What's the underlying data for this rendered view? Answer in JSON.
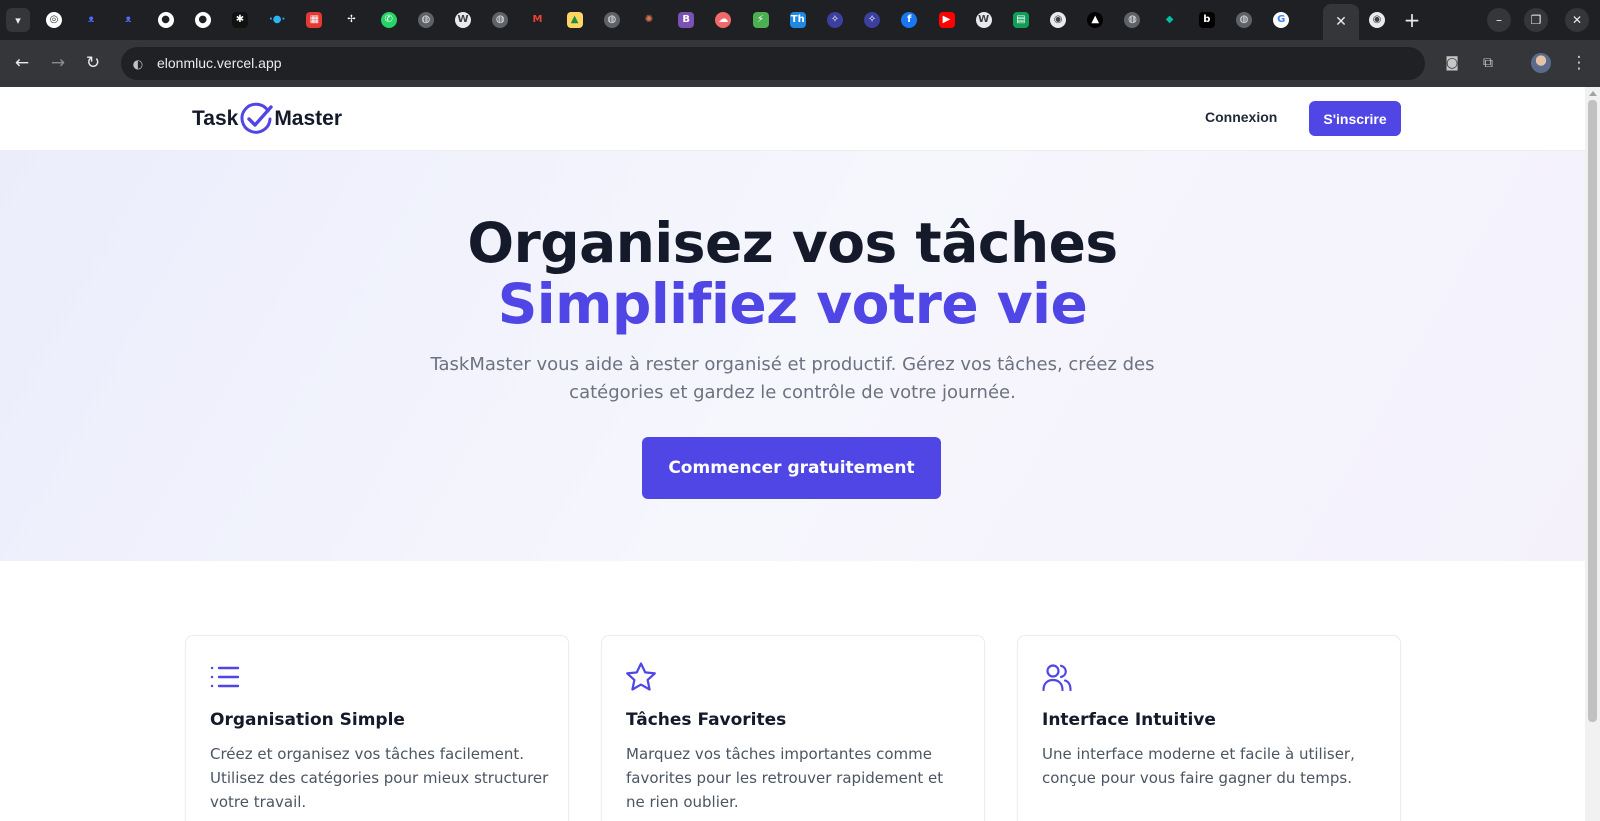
{
  "browser": {
    "tabs_menu_icon": "chevron-down-icon",
    "tab_favicons": [
      {
        "name": "openai-favicon",
        "bg": "#ffffff",
        "fg": "#1f2023",
        "glyph": "◎",
        "round": true
      },
      {
        "name": "deepseek-favicon",
        "bg": "transparent",
        "fg": "#4d6bfe",
        "glyph": "ᴥ",
        "round": false
      },
      {
        "name": "deepseek-favicon",
        "bg": "transparent",
        "fg": "#4d6bfe",
        "glyph": "ᴥ",
        "round": false
      },
      {
        "name": "github-favicon",
        "bg": "#ffffff",
        "fg": "#1f2023",
        "glyph": "●",
        "round": true
      },
      {
        "name": "github-favicon",
        "bg": "#ffffff",
        "fg": "#1f2023",
        "glyph": "●",
        "round": true
      },
      {
        "name": "pattern-favicon",
        "bg": "#111111",
        "fg": "#ffffff",
        "glyph": "✱",
        "round": false
      },
      {
        "name": "dots-favicon",
        "bg": "transparent",
        "fg": "#29b6f6",
        "glyph": "·●·",
        "round": false
      },
      {
        "name": "calendar-favicon",
        "bg": "#e53935",
        "fg": "#ffffff",
        "glyph": "▦",
        "round": false
      },
      {
        "name": "pinwheel-favicon",
        "bg": "transparent",
        "fg": "#ffffff",
        "glyph": "✢",
        "round": false
      },
      {
        "name": "whatsapp-favicon",
        "bg": "#25d366",
        "fg": "#ffffff",
        "glyph": "✆",
        "round": true
      },
      {
        "name": "globe-favicon",
        "bg": "#5f6368",
        "fg": "#e8eaed",
        "glyph": "◍",
        "round": true
      },
      {
        "name": "wordpress-favicon",
        "bg": "#e8eaed",
        "fg": "#3c4043",
        "glyph": "W",
        "round": true
      },
      {
        "name": "globe-favicon",
        "bg": "#5f6368",
        "fg": "#e8eaed",
        "glyph": "◍",
        "round": true
      },
      {
        "name": "gmail-favicon",
        "bg": "transparent",
        "fg": "#ea4335",
        "glyph": "M",
        "round": false
      },
      {
        "name": "image-favicon",
        "bg": "#fdd663",
        "fg": "#1e8e3e",
        "glyph": "▲",
        "round": false
      },
      {
        "name": "globe-favicon",
        "bg": "#5f6368",
        "fg": "#e8eaed",
        "glyph": "◍",
        "round": true
      },
      {
        "name": "claude-favicon",
        "bg": "transparent",
        "fg": "#d97757",
        "glyph": "✺",
        "round": false
      },
      {
        "name": "bootstrap-favicon",
        "bg": "#7952b3",
        "fg": "#ffffff",
        "glyph": "B",
        "round": false
      },
      {
        "name": "cloud-favicon",
        "bg": "#f06a6a",
        "fg": "#ffffff",
        "glyph": "☁",
        "round": true
      },
      {
        "name": "bolt-favicon",
        "bg": "#4caf50",
        "fg": "#ffffff",
        "glyph": "⚡",
        "round": false
      },
      {
        "name": "themeforest-favicon",
        "bg": "#1e88e5",
        "fg": "#ffffff",
        "glyph": "Th",
        "round": false
      },
      {
        "name": "vite-favicon",
        "bg": "#3b3f9e",
        "fg": "#ffffff",
        "glyph": "✧",
        "round": true
      },
      {
        "name": "vite-favicon",
        "bg": "#3b3f9e",
        "fg": "#ffffff",
        "glyph": "✧",
        "round": true
      },
      {
        "name": "facebook-favicon",
        "bg": "#1877f2",
        "fg": "#ffffff",
        "glyph": "f",
        "round": true
      },
      {
        "name": "youtube-favicon",
        "bg": "#ff0000",
        "fg": "#ffffff",
        "glyph": "▶",
        "round": false
      },
      {
        "name": "wordpress-favicon",
        "bg": "#e8eaed",
        "fg": "#3c4043",
        "glyph": "W",
        "round": true
      },
      {
        "name": "sheets-favicon",
        "bg": "#0f9d58",
        "fg": "#ffffff",
        "glyph": "▤",
        "round": false
      },
      {
        "name": "chrome-favicon",
        "bg": "#e8eaed",
        "fg": "#3c4043",
        "glyph": "◉",
        "round": true
      },
      {
        "name": "vercel-favicon",
        "bg": "#000000",
        "fg": "#ffffff",
        "glyph": "▲",
        "round": true
      },
      {
        "name": "globe-favicon",
        "bg": "#5f6368",
        "fg": "#e8eaed",
        "glyph": "◍",
        "round": true
      },
      {
        "name": "diamond-favicon",
        "bg": "transparent",
        "fg": "#00bfa5",
        "glyph": "◆",
        "round": false
      },
      {
        "name": "b-favicon",
        "bg": "#000000",
        "fg": "#ffffff",
        "glyph": "b",
        "round": false
      },
      {
        "name": "globe-favicon",
        "bg": "#5f6368",
        "fg": "#e8eaed",
        "glyph": "◍",
        "round": true
      },
      {
        "name": "google-favicon",
        "bg": "#ffffff",
        "fg": "#4285f4",
        "glyph": "G",
        "round": true
      }
    ],
    "active_tab_close": "✕",
    "after_tab_favicon": {
      "name": "chrome-favicon",
      "bg": "#e8eaed",
      "fg": "#3c4043",
      "glyph": "◉"
    },
    "new_tab_label": "+",
    "window_controls": {
      "minimize": "–",
      "restore": "❐",
      "close": "✕"
    },
    "nav": {
      "back": "←",
      "forward": "→",
      "reload": "↻"
    },
    "url": "elonmluc.vercel.app",
    "site_info_icon": "◐",
    "camera_icon": "◙",
    "extensions_icon": "⧉",
    "menu_icon": "⋮"
  },
  "site": {
    "logo": {
      "left": "Task",
      "right": "Master"
    },
    "nav": {
      "login": "Connexion",
      "signup": "S'inscrire"
    },
    "hero": {
      "title_line1": "Organisez vos tâches",
      "title_line2": "Simplifiez votre vie",
      "subtitle": "TaskMaster vous aide à rester organisé et productif. Gérez vos tâches, créez des catégories et gardez le contrôle de votre journée.",
      "cta": "Commencer gratuitement"
    },
    "features": [
      {
        "icon": "list-icon",
        "title": "Organisation Simple",
        "text": "Créez et organisez vos tâches facilement. Utilisez des catégories pour mieux structurer votre travail."
      },
      {
        "icon": "star-icon",
        "title": "Tâches Favorites",
        "text": "Marquez vos tâches importantes comme favorites pour les retrouver rapidement et ne rien oublier."
      },
      {
        "icon": "users-icon",
        "title": "Interface Intuitive",
        "text": "Une interface moderne et facile à utiliser, conçue pour vous faire gagner du temps."
      }
    ]
  },
  "colors": {
    "accent": "#4f46e5",
    "heading": "#141a2a",
    "muted_text": "#6b7280"
  }
}
